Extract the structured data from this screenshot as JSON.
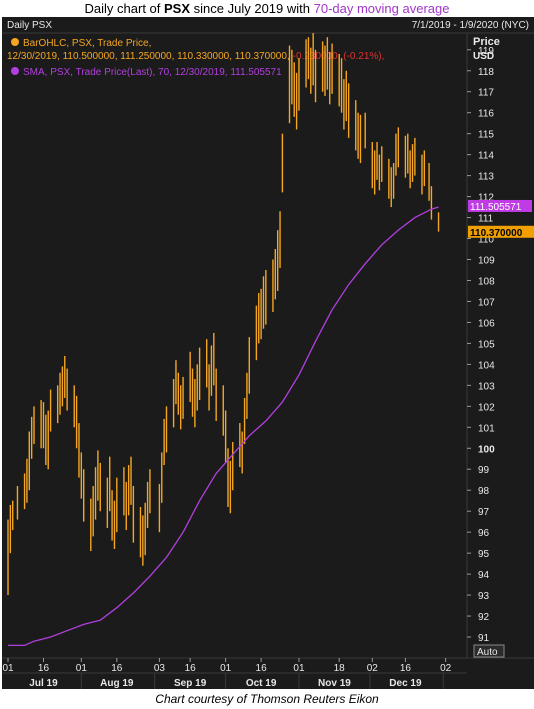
{
  "header": {
    "title_prefix": "Daily chart of ",
    "title_ticker": "PSX",
    "title_middle": " since July 2019 with ",
    "title_accent": "70-day moving average"
  },
  "panel": {
    "name": "Daily PSX",
    "date_range": "7/1/2019 - 1/9/2020 (NYC)",
    "price_label": "Price",
    "currency_label": "USD",
    "auto_button": "Auto"
  },
  "legend": {
    "bar_title": "BarOHLC, PSX, Trade Price,",
    "bar_values": "12/30/2019, 110.500000, 111.250000, 110.330000, 110.370000,",
    "bar_change": "-0.230000, (-0.21%),",
    "sma_line": "SMA, PSX, Trade Price(Last),  70,  12/30/2019, 111.505571"
  },
  "price_tags": {
    "sma": "111.505571",
    "last": "110.370000"
  },
  "footer": "Chart courtesy of Thomson Reuters Eikon",
  "colors": {
    "background": "#1b1b1b",
    "bars": "#f5a623",
    "sma": "#b23fe0",
    "sma_tag": "#c03ae6",
    "last_tag": "#f0a000",
    "change_negative": "#e23030",
    "axis_text": "#e8e8e8",
    "grid": "#2c2c2c"
  },
  "chart_data": {
    "type": "ohlc",
    "ylim": [
      90,
      119.8
    ],
    "y_ticks": [
      91,
      92,
      93,
      94,
      95,
      96,
      97,
      98,
      99,
      100,
      101,
      102,
      103,
      104,
      105,
      106,
      107,
      108,
      109,
      110,
      111,
      112,
      113,
      114,
      115,
      116,
      117,
      118,
      119
    ],
    "y_tick_bold": 100,
    "grid": false,
    "x_day_ticks": [
      {
        "date": "2019-07-01",
        "label": "01"
      },
      {
        "date": "2019-07-16",
        "label": "16"
      },
      {
        "date": "2019-08-01",
        "label": "01"
      },
      {
        "date": "2019-08-16",
        "label": "16"
      },
      {
        "date": "2019-09-03",
        "label": "03"
      },
      {
        "date": "2019-09-16",
        "label": "16"
      },
      {
        "date": "2019-10-01",
        "label": "01"
      },
      {
        "date": "2019-10-16",
        "label": "16"
      },
      {
        "date": "2019-11-01",
        "label": "01"
      },
      {
        "date": "2019-11-18",
        "label": "18"
      },
      {
        "date": "2019-12-02",
        "label": "02"
      },
      {
        "date": "2019-12-16",
        "label": "16"
      },
      {
        "date": "2020-01-02",
        "label": "02"
      }
    ],
    "x_month_labels": [
      {
        "date": "2019-07-16",
        "label": "Jul 19"
      },
      {
        "date": "2019-08-16",
        "label": "Aug 19"
      },
      {
        "date": "2019-09-16",
        "label": "Sep 19"
      },
      {
        "date": "2019-10-16",
        "label": "Oct 19"
      },
      {
        "date": "2019-11-16",
        "label": "Nov 19"
      },
      {
        "date": "2019-12-16",
        "label": "Dec 19"
      }
    ],
    "x_range": [
      "2019-07-01",
      "2020-01-03"
    ],
    "series": [
      {
        "type": "ohlc",
        "values": [
          {
            "date": "2019-07-01",
            "low": 93.0,
            "high": 96.6
          },
          {
            "date": "2019-07-02",
            "low": 95.0,
            "high": 97.3
          },
          {
            "date": "2019-07-03",
            "low": 96.1,
            "high": 97.5
          },
          {
            "date": "2019-07-05",
            "low": 96.6,
            "high": 98.2
          },
          {
            "date": "2019-07-08",
            "low": 97.1,
            "high": 98.8
          },
          {
            "date": "2019-07-09",
            "low": 97.4,
            "high": 99.5
          },
          {
            "date": "2019-07-10",
            "low": 98.0,
            "high": 100.8
          },
          {
            "date": "2019-07-11",
            "low": 99.5,
            "high": 101.5
          },
          {
            "date": "2019-07-12",
            "low": 100.2,
            "high": 102.0
          },
          {
            "date": "2019-07-15",
            "low": 100.0,
            "high": 102.3
          },
          {
            "date": "2019-07-16",
            "low": 100.0,
            "high": 102.2
          },
          {
            "date": "2019-07-17",
            "low": 99.2,
            "high": 101.6
          },
          {
            "date": "2019-07-18",
            "low": 99.0,
            "high": 101.8
          },
          {
            "date": "2019-07-19",
            "low": 100.8,
            "high": 102.8
          },
          {
            "date": "2019-07-22",
            "low": 101.2,
            "high": 103.0
          },
          {
            "date": "2019-07-23",
            "low": 101.6,
            "high": 103.6
          },
          {
            "date": "2019-07-24",
            "low": 102.0,
            "high": 103.9
          },
          {
            "date": "2019-07-25",
            "low": 102.4,
            "high": 104.4
          },
          {
            "date": "2019-07-26",
            "low": 101.8,
            "high": 103.8
          },
          {
            "date": "2019-07-29",
            "low": 101.0,
            "high": 103.0
          },
          {
            "date": "2019-07-30",
            "low": 100.0,
            "high": 102.5
          },
          {
            "date": "2019-07-31",
            "low": 98.6,
            "high": 101.2
          },
          {
            "date": "2019-08-01",
            "low": 97.6,
            "high": 99.8
          },
          {
            "date": "2019-08-02",
            "low": 96.5,
            "high": 99.0
          },
          {
            "date": "2019-08-05",
            "low": 95.1,
            "high": 97.6
          },
          {
            "date": "2019-08-06",
            "low": 95.8,
            "high": 98.2
          },
          {
            "date": "2019-08-07",
            "low": 96.6,
            "high": 99.1
          },
          {
            "date": "2019-08-08",
            "low": 97.5,
            "high": 99.9
          },
          {
            "date": "2019-08-09",
            "low": 97.0,
            "high": 99.3
          },
          {
            "date": "2019-08-12",
            "low": 96.2,
            "high": 98.6
          },
          {
            "date": "2019-08-13",
            "low": 97.0,
            "high": 99.6
          },
          {
            "date": "2019-08-14",
            "low": 95.6,
            "high": 98.0
          },
          {
            "date": "2019-08-15",
            "low": 95.2,
            "high": 97.5
          },
          {
            "date": "2019-08-16",
            "low": 96.0,
            "high": 98.6
          },
          {
            "date": "2019-08-19",
            "low": 96.8,
            "high": 99.1
          },
          {
            "date": "2019-08-20",
            "low": 96.1,
            "high": 98.4
          },
          {
            "date": "2019-08-21",
            "low": 96.8,
            "high": 99.2
          },
          {
            "date": "2019-08-22",
            "low": 97.3,
            "high": 99.6
          },
          {
            "date": "2019-08-23",
            "low": 95.5,
            "high": 98.2
          },
          {
            "date": "2019-08-26",
            "low": 94.8,
            "high": 97.2
          },
          {
            "date": "2019-08-27",
            "low": 94.4,
            "high": 96.8
          },
          {
            "date": "2019-08-28",
            "low": 94.9,
            "high": 97.4
          },
          {
            "date": "2019-08-29",
            "low": 96.2,
            "high": 98.4
          },
          {
            "date": "2019-08-30",
            "low": 96.9,
            "high": 99.0
          },
          {
            "date": "2019-09-03",
            "low": 96.0,
            "high": 98.3
          },
          {
            "date": "2019-09-04",
            "low": 97.4,
            "high": 99.8
          },
          {
            "date": "2019-09-05",
            "low": 99.2,
            "high": 101.4
          },
          {
            "date": "2019-09-06",
            "low": 99.8,
            "high": 102.0
          },
          {
            "date": "2019-09-09",
            "low": 101.0,
            "high": 103.3
          },
          {
            "date": "2019-09-10",
            "low": 102.1,
            "high": 104.2
          },
          {
            "date": "2019-09-11",
            "low": 101.6,
            "high": 103.6
          },
          {
            "date": "2019-09-12",
            "low": 100.9,
            "high": 103.0
          },
          {
            "date": "2019-09-13",
            "low": 101.4,
            "high": 103.4
          },
          {
            "date": "2019-09-16",
            "low": 102.2,
            "high": 104.6
          },
          {
            "date": "2019-09-17",
            "low": 101.5,
            "high": 103.8
          },
          {
            "date": "2019-09-18",
            "low": 101.0,
            "high": 103.3
          },
          {
            "date": "2019-09-19",
            "low": 101.8,
            "high": 104.0
          },
          {
            "date": "2019-09-20",
            "low": 102.3,
            "high": 104.8
          },
          {
            "date": "2019-09-23",
            "low": 102.9,
            "high": 105.2
          },
          {
            "date": "2019-09-24",
            "low": 101.8,
            "high": 104.0
          },
          {
            "date": "2019-09-25",
            "low": 102.5,
            "high": 104.9
          },
          {
            "date": "2019-09-26",
            "low": 103.0,
            "high": 105.5
          },
          {
            "date": "2019-09-27",
            "low": 101.3,
            "high": 103.8
          },
          {
            "date": "2019-09-30",
            "low": 100.6,
            "high": 103.0
          },
          {
            "date": "2019-10-01",
            "low": 99.3,
            "high": 101.8
          },
          {
            "date": "2019-10-02",
            "low": 97.2,
            "high": 100.0
          },
          {
            "date": "2019-10-03",
            "low": 96.9,
            "high": 99.4
          },
          {
            "date": "2019-10-04",
            "low": 98.0,
            "high": 100.3
          },
          {
            "date": "2019-10-07",
            "low": 99.1,
            "high": 101.2
          },
          {
            "date": "2019-10-08",
            "low": 98.8,
            "high": 100.8
          },
          {
            "date": "2019-10-09",
            "low": 100.2,
            "high": 102.4
          },
          {
            "date": "2019-10-10",
            "low": 101.4,
            "high": 103.6
          },
          {
            "date": "2019-10-11",
            "low": 102.6,
            "high": 105.3
          },
          {
            "date": "2019-10-14",
            "low": 104.2,
            "high": 106.8
          },
          {
            "date": "2019-10-15",
            "low": 105.0,
            "high": 107.4
          },
          {
            "date": "2019-10-16",
            "low": 105.2,
            "high": 107.6
          },
          {
            "date": "2019-10-17",
            "low": 105.7,
            "high": 108.2
          },
          {
            "date": "2019-10-18",
            "low": 105.9,
            "high": 108.5
          },
          {
            "date": "2019-10-21",
            "low": 106.5,
            "high": 109.0
          },
          {
            "date": "2019-10-22",
            "low": 107.1,
            "high": 109.5
          },
          {
            "date": "2019-10-23",
            "low": 107.5,
            "high": 110.4
          },
          {
            "date": "2019-10-24",
            "low": 108.6,
            "high": 111.3
          },
          {
            "date": "2019-10-25",
            "low": 112.2,
            "high": 115.0
          },
          {
            "date": "2019-10-28",
            "low": 115.5,
            "high": 119.2
          },
          {
            "date": "2019-10-29",
            "low": 116.4,
            "high": 119.0
          },
          {
            "date": "2019-10-30",
            "low": 115.8,
            "high": 118.4
          },
          {
            "date": "2019-10-31",
            "low": 115.2,
            "high": 117.9
          },
          {
            "date": "2019-11-01",
            "low": 116.1,
            "high": 118.6
          },
          {
            "date": "2019-11-04",
            "low": 117.2,
            "high": 119.5
          },
          {
            "date": "2019-11-05",
            "low": 117.6,
            "high": 119.6
          },
          {
            "date": "2019-11-06",
            "low": 116.9,
            "high": 119.1
          },
          {
            "date": "2019-11-07",
            "low": 117.3,
            "high": 119.8
          },
          {
            "date": "2019-11-08",
            "low": 116.5,
            "high": 119.0
          },
          {
            "date": "2019-11-11",
            "low": 117.0,
            "high": 119.4
          },
          {
            "date": "2019-11-12",
            "low": 116.8,
            "high": 119.2
          },
          {
            "date": "2019-11-13",
            "low": 117.1,
            "high": 119.6
          },
          {
            "date": "2019-11-14",
            "low": 116.4,
            "high": 118.9
          },
          {
            "date": "2019-11-15",
            "low": 116.9,
            "high": 119.3
          },
          {
            "date": "2019-11-18",
            "low": 116.3,
            "high": 118.8
          },
          {
            "date": "2019-11-19",
            "low": 116.0,
            "high": 118.6
          },
          {
            "date": "2019-11-20",
            "low": 115.2,
            "high": 117.6
          },
          {
            "date": "2019-11-21",
            "low": 115.6,
            "high": 118.0
          },
          {
            "date": "2019-11-22",
            "low": 114.8,
            "high": 117.4
          },
          {
            "date": "2019-11-25",
            "low": 114.2,
            "high": 116.6
          },
          {
            "date": "2019-11-26",
            "low": 113.8,
            "high": 116.0
          },
          {
            "date": "2019-11-27",
            "low": 113.6,
            "high": 115.9
          },
          {
            "date": "2019-11-29",
            "low": 114.3,
            "high": 116.0
          },
          {
            "date": "2019-12-02",
            "low": 112.4,
            "high": 114.6
          },
          {
            "date": "2019-12-03",
            "low": 112.1,
            "high": 114.2
          },
          {
            "date": "2019-12-04",
            "low": 112.8,
            "high": 114.6
          },
          {
            "date": "2019-12-05",
            "low": 112.3,
            "high": 114.0
          },
          {
            "date": "2019-12-06",
            "low": 112.7,
            "high": 114.4
          },
          {
            "date": "2019-12-09",
            "low": 111.9,
            "high": 113.8
          },
          {
            "date": "2019-12-10",
            "low": 111.5,
            "high": 113.4
          },
          {
            "date": "2019-12-11",
            "low": 111.9,
            "high": 113.6
          },
          {
            "date": "2019-12-12",
            "low": 113.0,
            "high": 115.0
          },
          {
            "date": "2019-12-13",
            "low": 113.4,
            "high": 115.3
          },
          {
            "date": "2019-12-16",
            "low": 112.9,
            "high": 114.9
          },
          {
            "date": "2019-12-17",
            "low": 113.1,
            "high": 115.0
          },
          {
            "date": "2019-12-18",
            "low": 112.4,
            "high": 114.2
          },
          {
            "date": "2019-12-19",
            "low": 112.7,
            "high": 114.5
          },
          {
            "date": "2019-12-20",
            "low": 113.0,
            "high": 114.8
          },
          {
            "date": "2019-12-23",
            "low": 112.1,
            "high": 114.0
          },
          {
            "date": "2019-12-24",
            "low": 112.5,
            "high": 114.2
          },
          {
            "date": "2019-12-26",
            "low": 111.8,
            "high": 113.6
          },
          {
            "date": "2019-12-27",
            "low": 110.9,
            "high": 112.5
          },
          {
            "date": "2019-12-30",
            "low": 110.33,
            "high": 111.25
          }
        ]
      },
      {
        "type": "line",
        "period": 70,
        "values": [
          {
            "date": "2019-07-01",
            "value": 90.6
          },
          {
            "date": "2019-07-08",
            "value": 90.6
          },
          {
            "date": "2019-07-12",
            "value": 90.8
          },
          {
            "date": "2019-07-19",
            "value": 91.0
          },
          {
            "date": "2019-07-26",
            "value": 91.3
          },
          {
            "date": "2019-08-02",
            "value": 91.6
          },
          {
            "date": "2019-08-09",
            "value": 91.8
          },
          {
            "date": "2019-08-16",
            "value": 92.4
          },
          {
            "date": "2019-08-23",
            "value": 93.1
          },
          {
            "date": "2019-08-30",
            "value": 93.9
          },
          {
            "date": "2019-09-06",
            "value": 94.8
          },
          {
            "date": "2019-09-13",
            "value": 96.0
          },
          {
            "date": "2019-09-20",
            "value": 97.5
          },
          {
            "date": "2019-09-27",
            "value": 98.8
          },
          {
            "date": "2019-10-04",
            "value": 99.7
          },
          {
            "date": "2019-10-11",
            "value": 100.6
          },
          {
            "date": "2019-10-18",
            "value": 101.3
          },
          {
            "date": "2019-10-25",
            "value": 102.2
          },
          {
            "date": "2019-11-01",
            "value": 103.5
          },
          {
            "date": "2019-11-08",
            "value": 105.1
          },
          {
            "date": "2019-11-15",
            "value": 106.6
          },
          {
            "date": "2019-11-22",
            "value": 107.8
          },
          {
            "date": "2019-11-29",
            "value": 108.8
          },
          {
            "date": "2019-12-06",
            "value": 109.7
          },
          {
            "date": "2019-12-13",
            "value": 110.4
          },
          {
            "date": "2019-12-20",
            "value": 111.0
          },
          {
            "date": "2019-12-27",
            "value": 111.4
          },
          {
            "date": "2019-12-30",
            "value": 111.505571
          }
        ]
      }
    ]
  }
}
